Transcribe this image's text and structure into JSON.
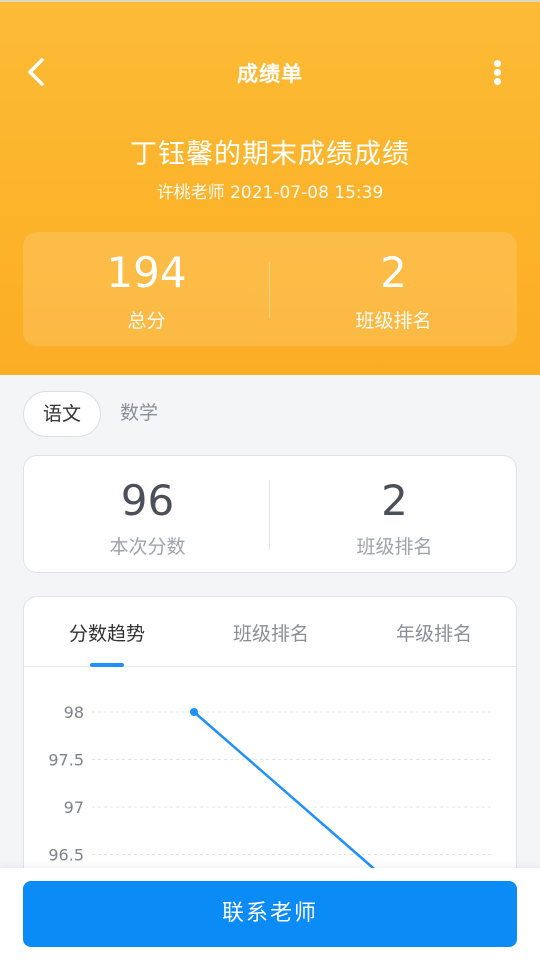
{
  "nav": {
    "title": "成绩单"
  },
  "report": {
    "title": "丁钰馨的期末成绩成绩",
    "subtitle": "许桃老师 2021-07-08 15:39"
  },
  "summary": {
    "total_value": "194",
    "total_label": "总分",
    "rank_value": "2",
    "rank_label": "班级排名"
  },
  "subjects": [
    {
      "label": "语文",
      "active": true
    },
    {
      "label": "数学",
      "active": false
    }
  ],
  "score": {
    "value": "96",
    "label": "本次分数",
    "rank_value": "2",
    "rank_label": "班级排名"
  },
  "chart_tabs": [
    {
      "label": "分数趋势",
      "active": true
    },
    {
      "label": "班级排名",
      "active": false
    },
    {
      "label": "年级排名",
      "active": false
    }
  ],
  "chart_data": {
    "type": "line",
    "y_ticks": [
      "98",
      "97.5",
      "97",
      "96.5"
    ],
    "ylim": [
      96.5,
      98
    ],
    "points": [
      {
        "y": 98
      },
      {
        "y": 96.35
      }
    ],
    "line_color": "#1e90ff",
    "grid": true
  },
  "bottom": {
    "contact_label": "联系老师"
  },
  "colors": {
    "header": "#fdb933",
    "primary": "#0a8bf5"
  }
}
